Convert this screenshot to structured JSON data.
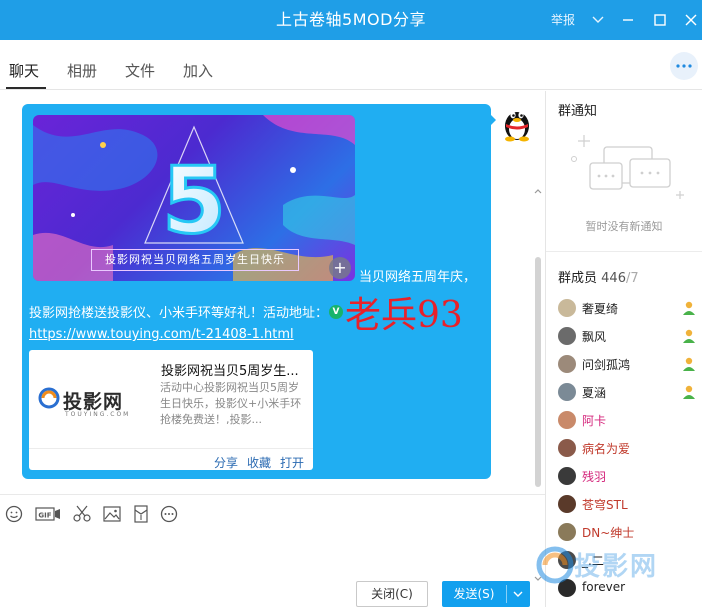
{
  "window": {
    "title": "上古卷轴5MOD分享",
    "report_label": "举报"
  },
  "tabs": [
    {
      "label": "聊天"
    },
    {
      "label": "相册"
    },
    {
      "label": "文件"
    },
    {
      "label": "加入"
    }
  ],
  "message": {
    "banner_caption": "投影网祝当贝网络五周岁生日快乐",
    "line1": "当贝网络五周年庆，",
    "line2": "投影网抢楼送投影仪、小米手环等好礼！活动地址：",
    "link": "https://www.touying.com/t-21408-1.html",
    "overlay_name": "老兵93",
    "card": {
      "logo_text": "投影网",
      "logo_sub": "TOUYING.COM",
      "title": "投影网祝当贝5周岁生...",
      "desc": "活动中心投影网祝当贝5周岁生日快乐，投影仪+小米手环抢楼免费送！,投影...",
      "actions": [
        "分享",
        "收藏",
        "打开"
      ]
    }
  },
  "buttons": {
    "close_label": "关闭(C)",
    "send_label": "发送(S)"
  },
  "notice": {
    "heading": "群通知",
    "empty_text": "暂时没有新通知"
  },
  "members": {
    "heading": "群成员",
    "count": "446",
    "total": "/7",
    "list": [
      {
        "name": "奢夏绮",
        "color": "#222222",
        "admin": true,
        "avatar": "#c9b99a"
      },
      {
        "name": "飘风",
        "color": "#222222",
        "admin": true,
        "avatar": "#6b6b6b"
      },
      {
        "name": "问剑孤鸿",
        "color": "#222222",
        "admin": true,
        "avatar": "#9c8a7a"
      },
      {
        "name": "夏涵",
        "color": "#222222",
        "admin": true,
        "avatar": "#7b8a96"
      },
      {
        "name": "阿卡",
        "color": "#d4237a",
        "admin": false,
        "avatar": "#c98a6a"
      },
      {
        "name": "病名为爱",
        "color": "#c0392b",
        "admin": false,
        "avatar": "#8a5a4a"
      },
      {
        "name": "残羽",
        "color": "#d4237a",
        "admin": false,
        "avatar": "#3a3a3a"
      },
      {
        "name": "苍穹STL",
        "color": "#c0392b",
        "admin": false,
        "avatar": "#5a3a2a"
      },
      {
        "name": "DN~绅士",
        "color": "#c0392b",
        "admin": false,
        "avatar": "#8a7a5a"
      },
      {
        "name": "_.二",
        "color": "#222222",
        "admin": false,
        "avatar": "#4a4a4a"
      },
      {
        "name": "forever",
        "color": "#222222",
        "admin": false,
        "avatar": "#2a2a2a"
      }
    ]
  },
  "watermark_text": "投影网"
}
